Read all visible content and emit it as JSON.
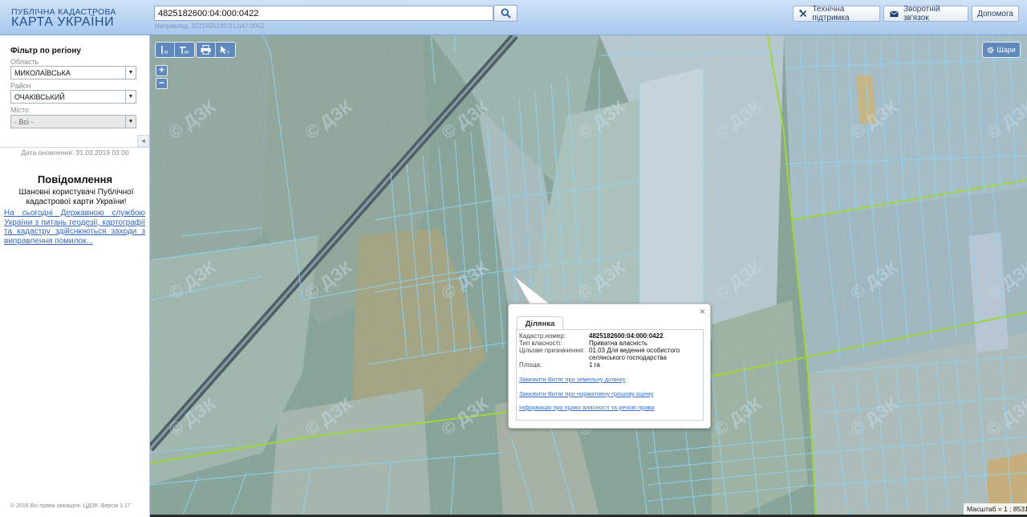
{
  "header": {
    "logo_line1": "ПУБЛІЧНА КАДАСТРОВА",
    "logo_line2": "КАРТА УКРАЇНИ",
    "search_value": "4825182600:04:000:0422",
    "search_example": "Наприклад: 3221655100:01:047:0052",
    "buttons": [
      {
        "label": "Технічна підтримка",
        "icon": "tools-icon"
      },
      {
        "label": "Зворотній зв'язок",
        "icon": "envelope-icon"
      },
      {
        "label": "Допомога"
      }
    ]
  },
  "sidebar": {
    "filter_title": "Фільтр по регіону",
    "region_label": "Область",
    "region_value": "МИКОЛАЇВСЬКА",
    "district_label": "Район",
    "district_value": "ОЧАКІВСЬКИЙ",
    "city_label": "Місто",
    "city_value": "- Всі -",
    "update_date": "Дата оновлення: 31.03.2019 03:00",
    "notice_title": "Повідомлення",
    "notice_greeting": "Шановні користувачі Публічної кадастрової карти України!",
    "notice_link": "На сьогодні Державною службою України з питань геодезії, картографії та кадастру здійснюються заходи з виправлення помилок...",
    "copyright": "© 2016 Всі права захищені. ЦДЗК. Версія 1.17"
  },
  "map": {
    "toolbar": [
      "ruler-m-icon",
      "area-m2-icon",
      "print-icon",
      "identify-cursor-icon"
    ],
    "zoom_in": "+",
    "zoom_out": "−",
    "layers_label": "Шари",
    "watermark": "© ДЗК",
    "scale_label": "Масштаб = 1 : 8531",
    "colors": {
      "parcel_line": "#8fd3f5",
      "boundary_line": "#9dd63a",
      "overlay": "#b8d2ea"
    }
  },
  "popup": {
    "tab_label": "Ділянка",
    "close": "×",
    "fields": [
      {
        "key": "Кадастр.номер:",
        "value": "4825182600:04:000:0422",
        "bold": true
      },
      {
        "key": "Тип власності:",
        "value": "Приватна власність"
      },
      {
        "key": "Цільове призначення:",
        "value": "01.03 Для ведення особистого селянського господарства"
      },
      {
        "key": "Площа:",
        "value": "1 га"
      }
    ],
    "links": [
      "Замовити Витяг про земельну ділянку",
      "Замовити Витяг про нормативну грошову оцінку",
      "Інформація про право власності та речові права"
    ]
  }
}
